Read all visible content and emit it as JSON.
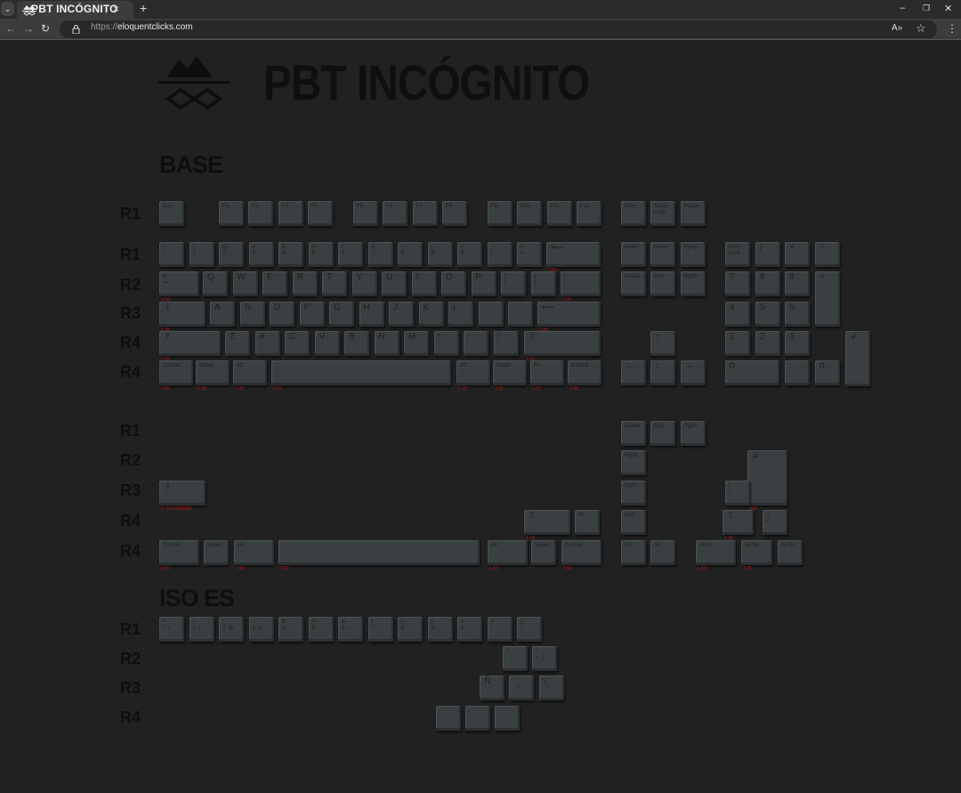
{
  "browser": {
    "tab_title": "PBT INCÓGNITO",
    "tab_close": "×",
    "tab_list": "⌄",
    "new_tab": "+",
    "url_protocol": "https://",
    "url_host": "eloquentclicks.com",
    "back": "←",
    "forward": "→",
    "reload": "↻",
    "lock_icon": "🔒",
    "read_aloud": "A»",
    "bookmark": "☆",
    "menu": "⋮",
    "minimize": "–",
    "restore": "❐",
    "close": "✕"
  },
  "page": {
    "brand": "PBT INCÓGNITO",
    "sections": {
      "base": "BASE",
      "iso_es": "ISO ES"
    },
    "row_labels": {
      "r1": "R1",
      "r2": "R2",
      "r3": "R3",
      "r4": "R4"
    }
  },
  "base_keys": [
    {
      "legend": "Esc",
      "sz": ""
    },
    {
      "legend": "F1",
      "sz": ""
    },
    {
      "legend": "F2",
      "sz": ""
    },
    {
      "legend": "F3",
      "sz": ""
    },
    {
      "legend": "F4",
      "sz": ""
    },
    {
      "legend": "F5",
      "sz": ""
    },
    {
      "legend": "F6",
      "sz": ""
    },
    {
      "legend": "F7",
      "sz": ""
    },
    {
      "legend": "F8",
      "sz": ""
    },
    {
      "legend": "F9",
      "sz": ""
    },
    {
      "legend": "F10",
      "sz": ""
    },
    {
      "legend": "F11",
      "sz": ""
    },
    {
      "legend": "F12",
      "sz": ""
    },
    {
      "legend": "Print",
      "sz": ""
    },
    {
      "legend": "Scroll\nLock",
      "sz": ""
    },
    {
      "legend": "Pause",
      "sz": ""
    },
    {
      "legend": "~\n`",
      "sz": ""
    },
    {
      "legend": "!\n1",
      "sz": ""
    },
    {
      "legend": "@\n2",
      "sz": ""
    },
    {
      "legend": "#\n3",
      "sz": ""
    },
    {
      "legend": "$\n4",
      "sz": ""
    },
    {
      "legend": "%\n5",
      "sz": ""
    },
    {
      "legend": "^\n6",
      "sz": ""
    },
    {
      "legend": "&\n7",
      "sz": ""
    },
    {
      "legend": "*\n8",
      "sz": ""
    },
    {
      "legend": "(\n9",
      "sz": ""
    },
    {
      "legend": ")\n0",
      "sz": ""
    },
    {
      "legend": "_\n-",
      "sz": ""
    },
    {
      "legend": "+\n=",
      "sz": ""
    },
    {
      "legend": "⟵",
      "sz": "2.00"
    },
    {
      "legend": "Insert",
      "sz": ""
    },
    {
      "legend": "Home",
      "sz": ""
    },
    {
      "legend": "PgUp",
      "sz": ""
    },
    {
      "legend": "Num\nLock",
      "sz": ""
    },
    {
      "legend": "/",
      "sz": ""
    },
    {
      "legend": "×",
      "sz": ""
    },
    {
      "legend": "−",
      "sz": ""
    },
    {
      "legend": "⇤\n⇥",
      "sz": "1.50"
    },
    {
      "legend": "Q",
      "sz": ""
    },
    {
      "legend": "W",
      "sz": ""
    },
    {
      "legend": "E",
      "sz": ""
    },
    {
      "legend": "R",
      "sz": ""
    },
    {
      "legend": "T",
      "sz": ""
    },
    {
      "legend": "Y",
      "sz": ""
    },
    {
      "legend": "U",
      "sz": ""
    },
    {
      "legend": "I",
      "sz": ""
    },
    {
      "legend": "O",
      "sz": ""
    },
    {
      "legend": "P",
      "sz": ""
    },
    {
      "legend": "{\n[",
      "sz": ""
    },
    {
      "legend": "}\n]",
      "sz": ""
    },
    {
      "legend": "|\n\\",
      "sz": "1.50"
    },
    {
      "legend": "Delete",
      "sz": ""
    },
    {
      "legend": "End",
      "sz": ""
    },
    {
      "legend": "PgDn",
      "sz": ""
    },
    {
      "legend": "7",
      "sz": ""
    },
    {
      "legend": "8",
      "sz": ""
    },
    {
      "legend": "9",
      "sz": ""
    },
    {
      "legend": "+",
      "sz": ""
    },
    {
      "legend": "⇩",
      "sz": "1.75"
    },
    {
      "legend": "A",
      "sz": ""
    },
    {
      "legend": "S",
      "sz": ""
    },
    {
      "legend": "D",
      "sz": ""
    },
    {
      "legend": "F",
      "sz": ""
    },
    {
      "legend": "G",
      "sz": ""
    },
    {
      "legend": "H",
      "sz": ""
    },
    {
      "legend": "J",
      "sz": ""
    },
    {
      "legend": "K",
      "sz": ""
    },
    {
      "legend": "L",
      "sz": ""
    },
    {
      "legend": ":\n;",
      "sz": ""
    },
    {
      "legend": "\"\n'",
      "sz": ""
    },
    {
      "legend": "⟵",
      "sz": "2.25"
    },
    {
      "legend": "4",
      "sz": ""
    },
    {
      "legend": "5",
      "sz": ""
    },
    {
      "legend": "6",
      "sz": ""
    },
    {
      "legend": "⇧",
      "sz": "2.25"
    },
    {
      "legend": "Z",
      "sz": ""
    },
    {
      "legend": "X",
      "sz": ""
    },
    {
      "legend": "C",
      "sz": ""
    },
    {
      "legend": "V",
      "sz": ""
    },
    {
      "legend": "B",
      "sz": ""
    },
    {
      "legend": "N",
      "sz": ""
    },
    {
      "legend": "M",
      "sz": ""
    },
    {
      "legend": "<\n,",
      "sz": ""
    },
    {
      "legend": ">\n.",
      "sz": ""
    },
    {
      "legend": "?\n/",
      "sz": ""
    },
    {
      "legend": "⇧",
      "sz": "2.75"
    },
    {
      "legend": "↑",
      "sz": ""
    },
    {
      "legend": "1",
      "sz": ""
    },
    {
      "legend": "2",
      "sz": ""
    },
    {
      "legend": "3",
      "sz": ""
    },
    {
      "legend": "↲",
      "sz": ""
    },
    {
      "legend": "Control",
      "sz": "1.25"
    },
    {
      "legend": "Super",
      "sz": "1.25"
    },
    {
      "legend": "Alt",
      "sz": "1.25"
    },
    {
      "legend": "",
      "sz": "6.25"
    },
    {
      "legend": "Alt",
      "sz": "1.25"
    },
    {
      "legend": "Super",
      "sz": "1.25"
    },
    {
      "legend": "Fn",
      "sz": "1.25"
    },
    {
      "legend": "Control",
      "sz": "1.25"
    },
    {
      "legend": "←",
      "sz": ""
    },
    {
      "legend": "↓",
      "sz": ""
    },
    {
      "legend": "→",
      "sz": ""
    },
    {
      "legend": "0",
      "sz": ""
    },
    {
      "legend": ".",
      "sz": ""
    },
    {
      "legend": "0",
      "sz": ""
    }
  ],
  "extra_keys": [
    {
      "legend": "Delete",
      "sz": ""
    },
    {
      "legend": "End",
      "sz": ""
    },
    {
      "legend": "PgDn",
      "sz": ""
    },
    {
      "legend": "PgUp",
      "sz": ""
    },
    {
      "legend": "↲",
      "sz": "ISO"
    },
    {
      "legend": "⇩",
      "sz": "1.75 STEPPED"
    },
    {
      "legend": "PgDn",
      "sz": ""
    },
    {
      "legend": "|\n\\",
      "sz": ""
    },
    {
      "legend": "⇧",
      "sz": "1.75"
    },
    {
      "legend": "Fn",
      "sz": ""
    },
    {
      "legend": "End",
      "sz": ""
    },
    {
      "legend": "⇧",
      "sz": "1.25"
    },
    {
      "legend": ">\n<",
      "sz": ""
    },
    {
      "legend": "Control",
      "sz": "1.50"
    },
    {
      "legend": "Super",
      "sz": ""
    },
    {
      "legend": "Alt",
      "sz": "1.50"
    },
    {
      "legend": "",
      "sz": "7.00"
    },
    {
      "legend": "Alt",
      "sz": "1.50"
    },
    {
      "legend": "Super",
      "sz": ""
    },
    {
      "legend": "Control",
      "sz": "1.50"
    },
    {
      "legend": "Ctrl",
      "sz": ""
    },
    {
      "legend": "Alt",
      "sz": ""
    },
    {
      "legend": "Alt Gr",
      "sz": "1.50"
    },
    {
      "legend": "Alt Gr",
      "sz": "1.25"
    },
    {
      "legend": "Alt Gr",
      "sz": ""
    }
  ],
  "iso_keys": [
    {
      "legend": "ª\nº  \\",
      "sz": ""
    },
    {
      "legend": "!\n1  |",
      "sz": ""
    },
    {
      "legend": "\"\n2  @",
      "sz": ""
    },
    {
      "legend": "·\n3  #",
      "sz": ""
    },
    {
      "legend": "$\n4  ~",
      "sz": ""
    },
    {
      "legend": "%\n5",
      "sz": ""
    },
    {
      "legend": "&\n6  ¬",
      "sz": ""
    },
    {
      "legend": "/\n7",
      "sz": ""
    },
    {
      "legend": "(\n8",
      "sz": ""
    },
    {
      "legend": ")\n9",
      "sz": ""
    },
    {
      "legend": "=\n0",
      "sz": ""
    },
    {
      "legend": "?\n'",
      "sz": ""
    },
    {
      "legend": "¿\n¡",
      "sz": ""
    },
    {
      "legend": "^\n`  [",
      "sz": ""
    },
    {
      "legend": "*\n+  ]",
      "sz": ""
    },
    {
      "legend": "Ñ",
      "sz": ""
    },
    {
      "legend": "¨\n´  {",
      "sz": ""
    },
    {
      "legend": "Ç\n   }",
      "sz": ""
    },
    {
      "legend": ";\n,",
      "sz": ""
    },
    {
      "legend": ":\n.",
      "sz": ""
    },
    {
      "legend": "_\n-",
      "sz": ""
    }
  ]
}
